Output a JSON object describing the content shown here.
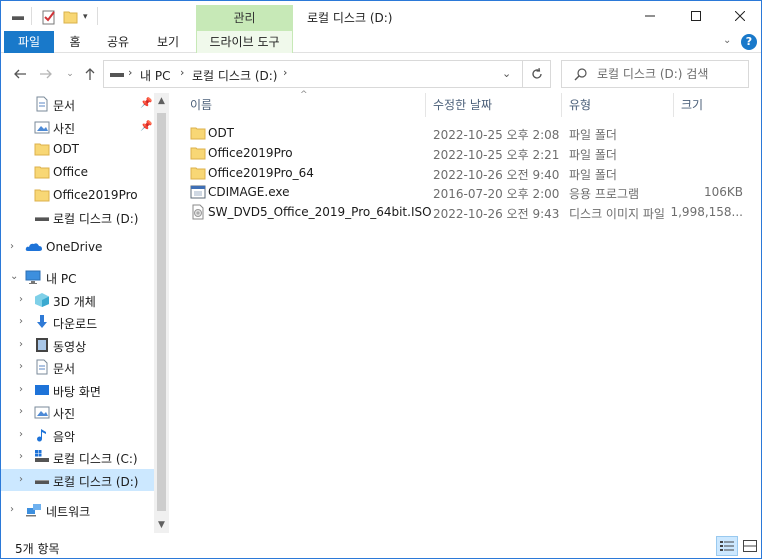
{
  "window": {
    "title": "로컬 디스크 (D:)",
    "context_tab_group": "관리"
  },
  "ribbon": {
    "tabs": [
      {
        "label": "파일"
      },
      {
        "label": "홈"
      },
      {
        "label": "공유"
      },
      {
        "label": "보기"
      },
      {
        "label": "드라이브 도구"
      }
    ]
  },
  "address": {
    "crumbs": [
      "내 PC",
      "로컬 디스크 (D:)"
    ]
  },
  "search": {
    "placeholder": "로컬 디스크 (D:) 검색"
  },
  "nav": {
    "quick_access": [
      {
        "label": "문서",
        "icon": "document-icon",
        "pinned": true
      },
      {
        "label": "사진",
        "icon": "pictures-icon",
        "pinned": true
      },
      {
        "label": "ODT",
        "icon": "folder-icon"
      },
      {
        "label": "Office",
        "icon": "folder-icon"
      },
      {
        "label": "Office2019Pro",
        "icon": "folder-icon"
      },
      {
        "label": "로컬 디스크 (D:)",
        "icon": "drive-icon"
      }
    ],
    "onedrive": "OneDrive",
    "this_pc": "내 PC",
    "this_pc_items": [
      {
        "label": "3D 개체",
        "icon": "3d-objects-icon"
      },
      {
        "label": "다운로드",
        "icon": "downloads-icon"
      },
      {
        "label": "동영상",
        "icon": "videos-icon"
      },
      {
        "label": "문서",
        "icon": "document-icon"
      },
      {
        "label": "바탕 화면",
        "icon": "desktop-icon"
      },
      {
        "label": "사진",
        "icon": "pictures-icon"
      },
      {
        "label": "음악",
        "icon": "music-icon"
      },
      {
        "label": "로컬 디스크 (C:)",
        "icon": "system-drive-icon"
      },
      {
        "label": "로컬 디스크 (D:)",
        "icon": "drive-icon",
        "selected": true
      }
    ],
    "network": "네트워크"
  },
  "columns": {
    "name": "이름",
    "date": "수정한 날짜",
    "type": "유형",
    "size": "크기"
  },
  "files": [
    {
      "name": "ODT",
      "date": "2022-10-25 오후 2:08",
      "type": "파일 폴더",
      "size": "",
      "icon": "folder-icon"
    },
    {
      "name": "Office2019Pro",
      "date": "2022-10-25 오후 2:21",
      "type": "파일 폴더",
      "size": "",
      "icon": "folder-icon"
    },
    {
      "name": "Office2019Pro_64",
      "date": "2022-10-26 오전 9:40",
      "type": "파일 폴더",
      "size": "",
      "icon": "folder-icon"
    },
    {
      "name": "CDIMAGE.exe",
      "date": "2016-07-20 오후 2:00",
      "type": "응용 프로그램",
      "size": "106KB",
      "icon": "exe-icon"
    },
    {
      "name": "SW_DVD5_Office_2019_Pro_64bit.ISO",
      "date": "2022-10-26 오전 9:43",
      "type": "디스크 이미지 파일",
      "size": "1,998,158...",
      "icon": "disc-image-icon"
    }
  ],
  "status": {
    "item_count": "5개 항목"
  },
  "colors": {
    "accent": "#1979ca",
    "context_tab": "#c7e9b7",
    "selection": "#cce8ff",
    "folder": "#f8d775",
    "header_text": "#4c607a"
  }
}
